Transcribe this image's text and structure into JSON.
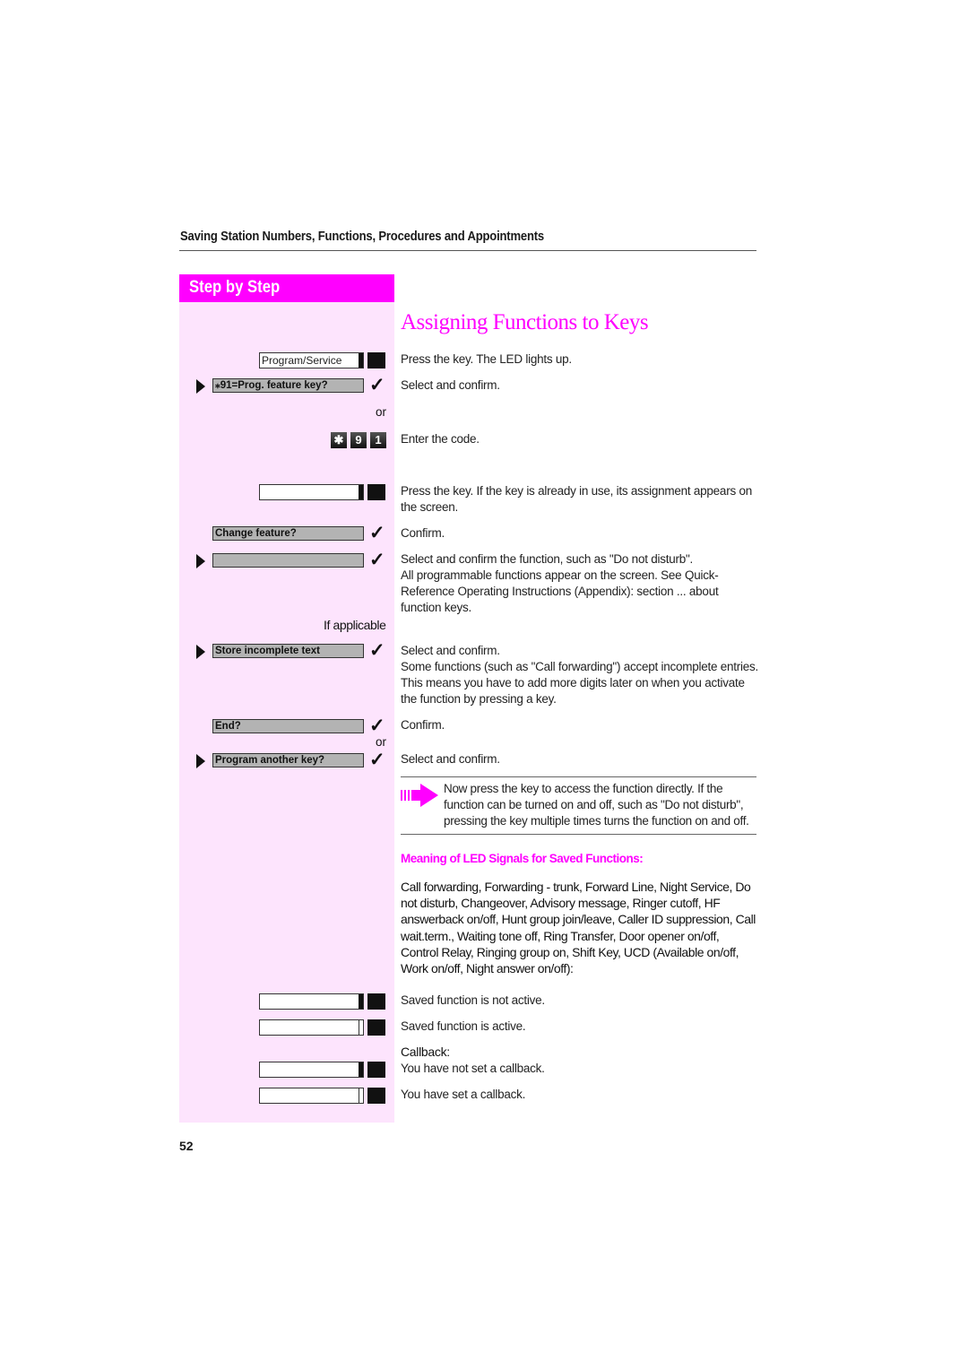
{
  "header": {
    "title": "Saving Station Numbers, Functions, Procedures and Appointments"
  },
  "sidebar": {
    "banner": "Step by Step",
    "steps": {
      "program_service_key": "Program/Service",
      "prog_feature_display": "⁎91=Prog. feature key?",
      "or_1": "or",
      "code_keys": [
        "✱",
        "9",
        "1"
      ],
      "change_feature_display": "Change feature?",
      "function_display": "",
      "if_applicable": "If applicable",
      "store_incomplete_display": "Store incomplete text",
      "end_display": "End?",
      "or_2": "or",
      "program_another_display": "Program another key?"
    }
  },
  "main": {
    "heading": "Assigning Functions to Keys",
    "instructions": {
      "press_key_led": "Press the key. The LED lights up.",
      "select_confirm_1": "Select and confirm.",
      "enter_code": "Enter the code.",
      "press_key_assignment": "Press the key. If the key is already in use, its assignment appears on the screen.",
      "confirm_1": "Confirm.",
      "select_function": "Select and confirm the function, such as \"Do not disturb\".",
      "all_functions": "All programmable functions appear on the screen. See Quick-Reference Operating Instructions (Appendix): section ... about function keys.",
      "select_confirm_2": "Select and confirm.",
      "incomplete_entries": "Some functions (such as \"Call forwarding\") accept incomplete entries. This means you have to add more digits later on when you activate the function by pressing a key.",
      "confirm_2": "Confirm.",
      "select_confirm_3": "Select and confirm."
    },
    "note": "Now press the key to access the function directly. If the function can be turned on and off, such as \"Do not disturb\", pressing the key multiple times turns the function on and off.",
    "led_section": {
      "title": "Meaning of LED Signals for Saved Functions:",
      "functions_list": "Call forwarding, Forwarding - trunk, Forward Line, Night Service, Do not disturb, Changeover, Advisory message, Ringer cutoff, HF answerback on/off, Hunt group join/leave, Caller ID suppression, Call wait.term., Waiting tone off, Ring Transfer, Door opener on/off, Control Relay, Ringing group on, Shift Key, UCD (Available on/off, Work on/off, Night answer on/off):",
      "not_active": "Saved function is not active.",
      "active": "Saved  function is active.",
      "callback_title": "Callback:",
      "callback_not_set": "You have not set a callback.",
      "callback_set": "You have set a callback."
    }
  },
  "footer": {
    "page_number": "52"
  },
  "colors": {
    "accent": "#ff00ff",
    "sidebar_bg": "#fde4fd",
    "display_bg": "#b3b3b3"
  }
}
